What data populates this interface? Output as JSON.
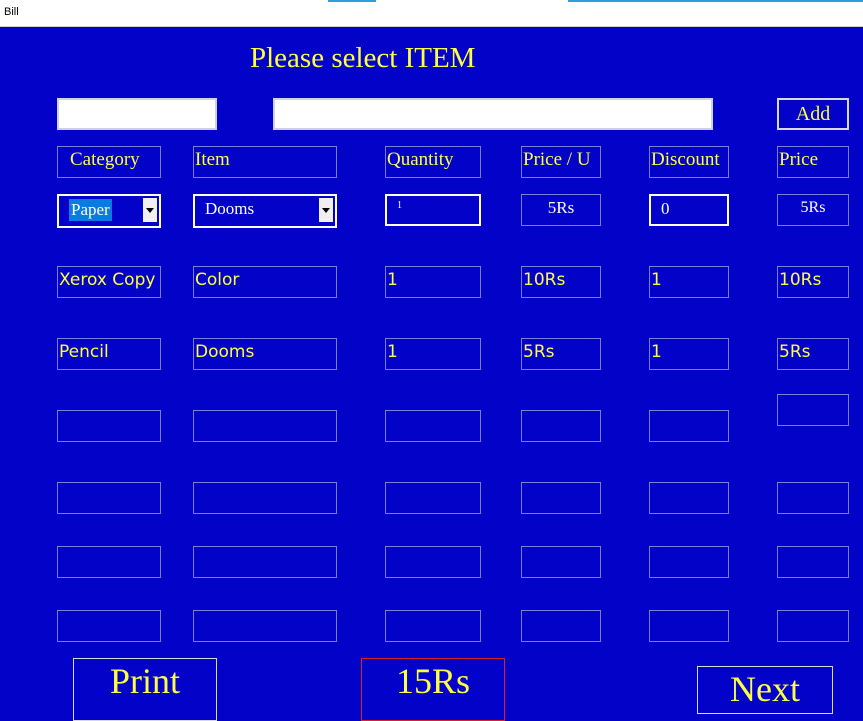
{
  "window": {
    "title": "Bill"
  },
  "heading": "Please select ITEM",
  "toolbar": {
    "add_label": "Add"
  },
  "columns": [
    "Category",
    "Item",
    "Quantity",
    "Price / U",
    "Discount",
    "Price"
  ],
  "selection_row": {
    "category": "Paper",
    "item": "Dooms",
    "quantity": "1",
    "unit_price": "5Rs",
    "discount": "0",
    "price": "5Rs"
  },
  "rows": [
    {
      "category": "Xerox Copy",
      "item": "Color",
      "quantity": "1",
      "unit_price": "10Rs",
      "discount": "1",
      "price": "10Rs"
    },
    {
      "category": "Pencil",
      "item": "Dooms",
      "quantity": "1",
      "unit_price": "5Rs",
      "discount": "1",
      "price": "5Rs"
    }
  ],
  "footer": {
    "print_label": "Print",
    "total": "15Rs",
    "next_label": "Next"
  },
  "colors": {
    "background": "#0202c8",
    "text": "#ffff44",
    "total_border": "#e02020",
    "selection": "#0a7be0"
  }
}
